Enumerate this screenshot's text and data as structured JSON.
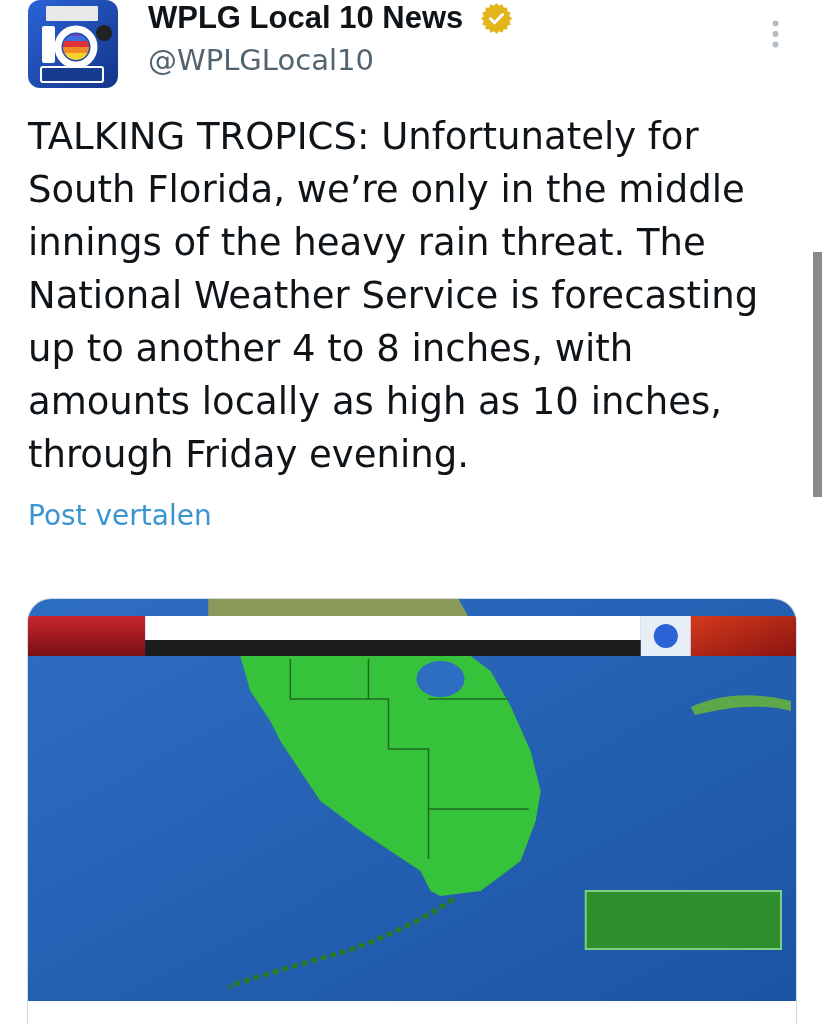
{
  "author": {
    "name": "WPLG Local 10 News",
    "verified": true,
    "handle": "@WPLGLocal10"
  },
  "post": {
    "text": "TALKING TROPICS: Unfortunately for South Florida, we’re only in the middle innings of the heavy rain threat. The National Weather Service is forecasting up to another 4 to 8 inches, with amounts locally as high as 10 inches, through Friday evening.",
    "translate_link": "Post vertalen"
  }
}
